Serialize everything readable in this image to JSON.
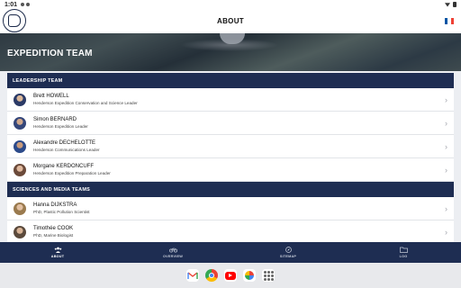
{
  "status_bar": {
    "time": "1:01"
  },
  "app_bar": {
    "title": "ABOUT",
    "logo_icon": "expedition-logo-icon",
    "language_icon": "french-flag-icon"
  },
  "hero": {
    "title": "EXPEDITION TEAM"
  },
  "sections": [
    {
      "title": "LEADERSHIP TEAM",
      "members": [
        {
          "name": "Brett HOWELL",
          "role": "Henderson Expedition Conservation and Science Leader"
        },
        {
          "name": "Simon BERNARD",
          "role": "Henderson Expedition Leader"
        },
        {
          "name": "Alexandre DECHELOTTE",
          "role": "Henderson Communications Leader"
        },
        {
          "name": "Morgane KERDONCUFF",
          "role": "Henderson Expedition Preparation Leader"
        }
      ]
    },
    {
      "title": "SCIENCES AND MEDIA TEAMS",
      "members": [
        {
          "name": "Hanna DIJKSTRA",
          "role": "PhD, Plastic Pollution Scientist"
        },
        {
          "name": "Timothée COOK",
          "role": "PhD, Marine Biologist"
        }
      ]
    }
  ],
  "bottom_nav": [
    {
      "label": "ABOUT",
      "icon": "people-icon",
      "active": true
    },
    {
      "label": "OVERVIEW",
      "icon": "bicycle-icon",
      "active": false
    },
    {
      "label": "SITEMAP",
      "icon": "compass-icon",
      "active": false
    },
    {
      "label": "LOG",
      "icon": "folder-icon",
      "active": false
    }
  ],
  "taskbar_apps": [
    "gmail-icon",
    "chrome-icon",
    "youtube-icon",
    "photos-icon",
    "app-drawer-icon"
  ],
  "colors": {
    "navy": "#1e2d52",
    "background": "#eceef2",
    "flag_blue": "#0055a4",
    "flag_white": "#ffffff",
    "flag_red": "#ef4135"
  }
}
